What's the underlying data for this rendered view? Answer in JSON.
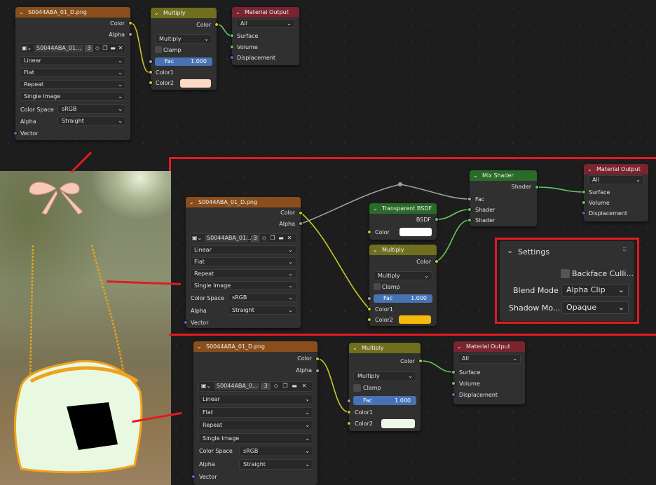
{
  "chevron": "⌄",
  "dropdown_arrow": "⌄",
  "texture_nodes": [
    {
      "title": "S0044ABA_01_D.png",
      "out_color": "Color",
      "out_alpha": "Alpha",
      "image_name": "S0044ABA_01...",
      "users": "3",
      "interpolation": "Linear",
      "projection": "Flat",
      "extension": "Repeat",
      "source": "Single Image",
      "color_space_label": "Color Space",
      "color_space": "sRGB",
      "alpha_label": "Alpha",
      "alpha_mode": "Straight",
      "vector": "Vector"
    },
    {
      "title": "S0044ABA_01_D.png",
      "out_color": "Color",
      "out_alpha": "Alpha",
      "image_name": "S0044ABA_01...",
      "users": "3",
      "interpolation": "Linear",
      "projection": "Flat",
      "extension": "Repeat",
      "source": "Single Image",
      "color_space_label": "Color Space",
      "color_space": "sRGB",
      "alpha_label": "Alpha",
      "alpha_mode": "Straight",
      "vector": "Vector"
    },
    {
      "title": "S0044ABA_01_D.png",
      "out_color": "Color",
      "out_alpha": "Alpha",
      "image_name": "S0044ABA_0...",
      "users": "3",
      "interpolation": "Linear",
      "projection": "Flat",
      "extension": "Repeat",
      "source": "Single Image",
      "color_space_label": "Color Space",
      "color_space": "sRGB",
      "alpha_label": "Alpha",
      "alpha_mode": "Straight",
      "vector": "Vector"
    }
  ],
  "multiply_nodes": [
    {
      "title": "Multiply",
      "out": "Color",
      "op": "Multiply",
      "clamp": "Clamp",
      "fac_label": "Fac",
      "fac": "1.000",
      "color1": "Color1",
      "color2": "Color2",
      "color2_swatch": "#fcd9c6"
    },
    {
      "title": "Multiply",
      "out": "Color",
      "op": "Multiply",
      "clamp": "Clamp",
      "fac_label": "Fac",
      "fac": "1.000",
      "color1": "Color1",
      "color2": "Color2",
      "color2_swatch": "#f5b80c"
    },
    {
      "title": "Multiply",
      "out": "Color",
      "op": "Multiply",
      "clamp": "Clamp",
      "fac_label": "Fac",
      "fac": "1.000",
      "color1": "Color1",
      "color2": "Color2",
      "color2_swatch": "#eef8e6"
    }
  ],
  "output_nodes": [
    {
      "title": "Material Output",
      "target": "All",
      "surface": "Surface",
      "volume": "Volume",
      "displacement": "Displacement"
    },
    {
      "title": "Material Output",
      "target": "All",
      "surface": "Surface",
      "volume": "Volume",
      "displacement": "Displacement"
    },
    {
      "title": "Material Output",
      "target": "All",
      "surface": "Surface",
      "volume": "Volume",
      "displacement": "Displacement"
    }
  ],
  "transparent": {
    "title": "Transparent BSDF",
    "out": "BSDF",
    "color": "Color",
    "swatch": "#ffffff"
  },
  "mix": {
    "title": "Mix Shader",
    "out": "Shader",
    "fac": "Fac",
    "shader1": "Shader",
    "shader2": "Shader"
  },
  "settings": {
    "title": "Settings",
    "backface": "Backface Culli...",
    "blend_label": "Blend Mode",
    "blend_value": "Alpha Clip",
    "shadow_label": "Shadow Mo...",
    "shadow_value": "Opaque"
  },
  "colors": {
    "highlight": "#e01b22",
    "texture_header": "#8a4e1c",
    "math_header": "#6f6f1e",
    "output_header": "#7a2430",
    "shader_header": "#2b6b2a",
    "fac_slider": "#4772b3",
    "socket_color": "#c7c729",
    "socket_shader": "#63c763",
    "socket_float": "#a1a1a1",
    "socket_vector": "#6363c7"
  }
}
